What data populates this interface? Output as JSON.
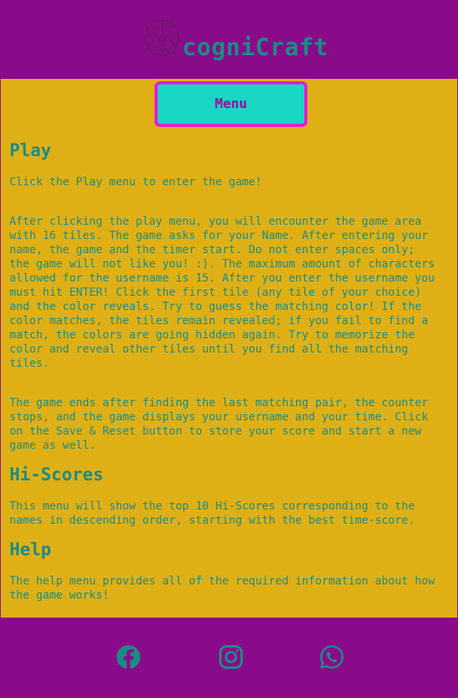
{
  "header": {
    "brand": "cogniCraft",
    "logo_icon": "brain-icon"
  },
  "nav": {
    "menu_label": "Menu"
  },
  "sections": {
    "play": {
      "title": "Play",
      "intro": "Click the Play menu to enter the game!",
      "para1": "After clicking the play menu, you will encounter the game area\nwith 16 tiles. The game asks for your Name. After entering your\nname, the game and the timer start. Do not enter spaces only;\nthe game will not like you! :). The maximum amount of characters\nallowed for the username is 15. After you enter the username you\nmust hit ENTER! Click the first tile (any tile of your choice)\nand the color reveals. Try to guess the matching color! If the\ncolor matches, the tiles remain revealed; if you fail to find a\nmatch, the colors are going hidden again. Try to memorize the\ncolor and reveal other tiles until you find all the matching\ntiles.",
      "para2": "The game ends after finding the last matching pair, the counter\nstops, and the game displays your username and your time. Click\non the Save & Reset button to store your score and start a new\ngame as well."
    },
    "hiscores": {
      "title": "Hi-Scores",
      "text": "This menu will show the top 10 Hi-Scores corresponding to the\nnames in descending order, starting with the best time-score."
    },
    "help": {
      "title": "Help",
      "text": "The help menu provides all of the required information about how\nthe game works!"
    }
  },
  "footer": {
    "icons": [
      "facebook-icon",
      "instagram-icon",
      "whatsapp-icon"
    ]
  },
  "colors": {
    "header_bg": "#8a0b8a",
    "body_bg": "#dfb015",
    "text": "#1a8c86",
    "button_bg": "#18d6c4",
    "button_border": "#e91ad3",
    "button_text": "#9a0aa0"
  }
}
